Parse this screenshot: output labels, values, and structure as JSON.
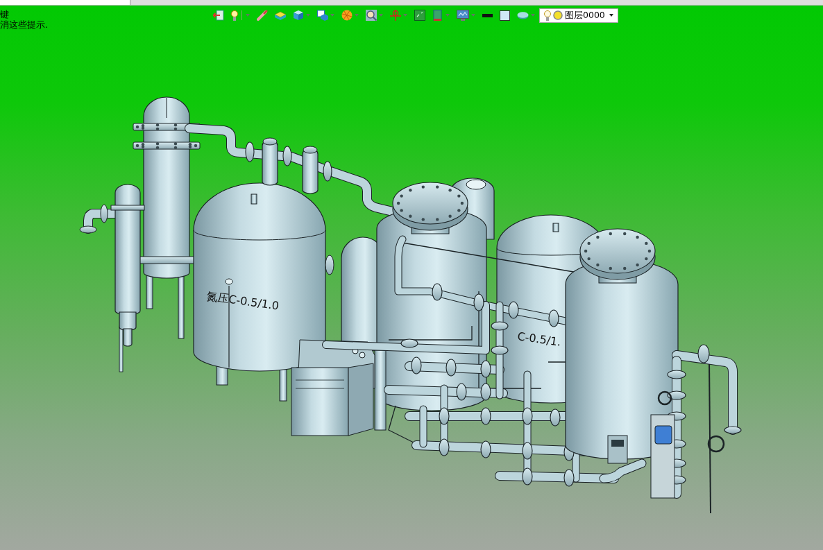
{
  "hints": [
    "键",
    "消这些提示."
  ],
  "layer_select": {
    "value": "图层0000"
  },
  "model": {
    "tank_labels": [
      "氮压C-0.5/1.0",
      "C-0.5/1."
    ]
  }
}
